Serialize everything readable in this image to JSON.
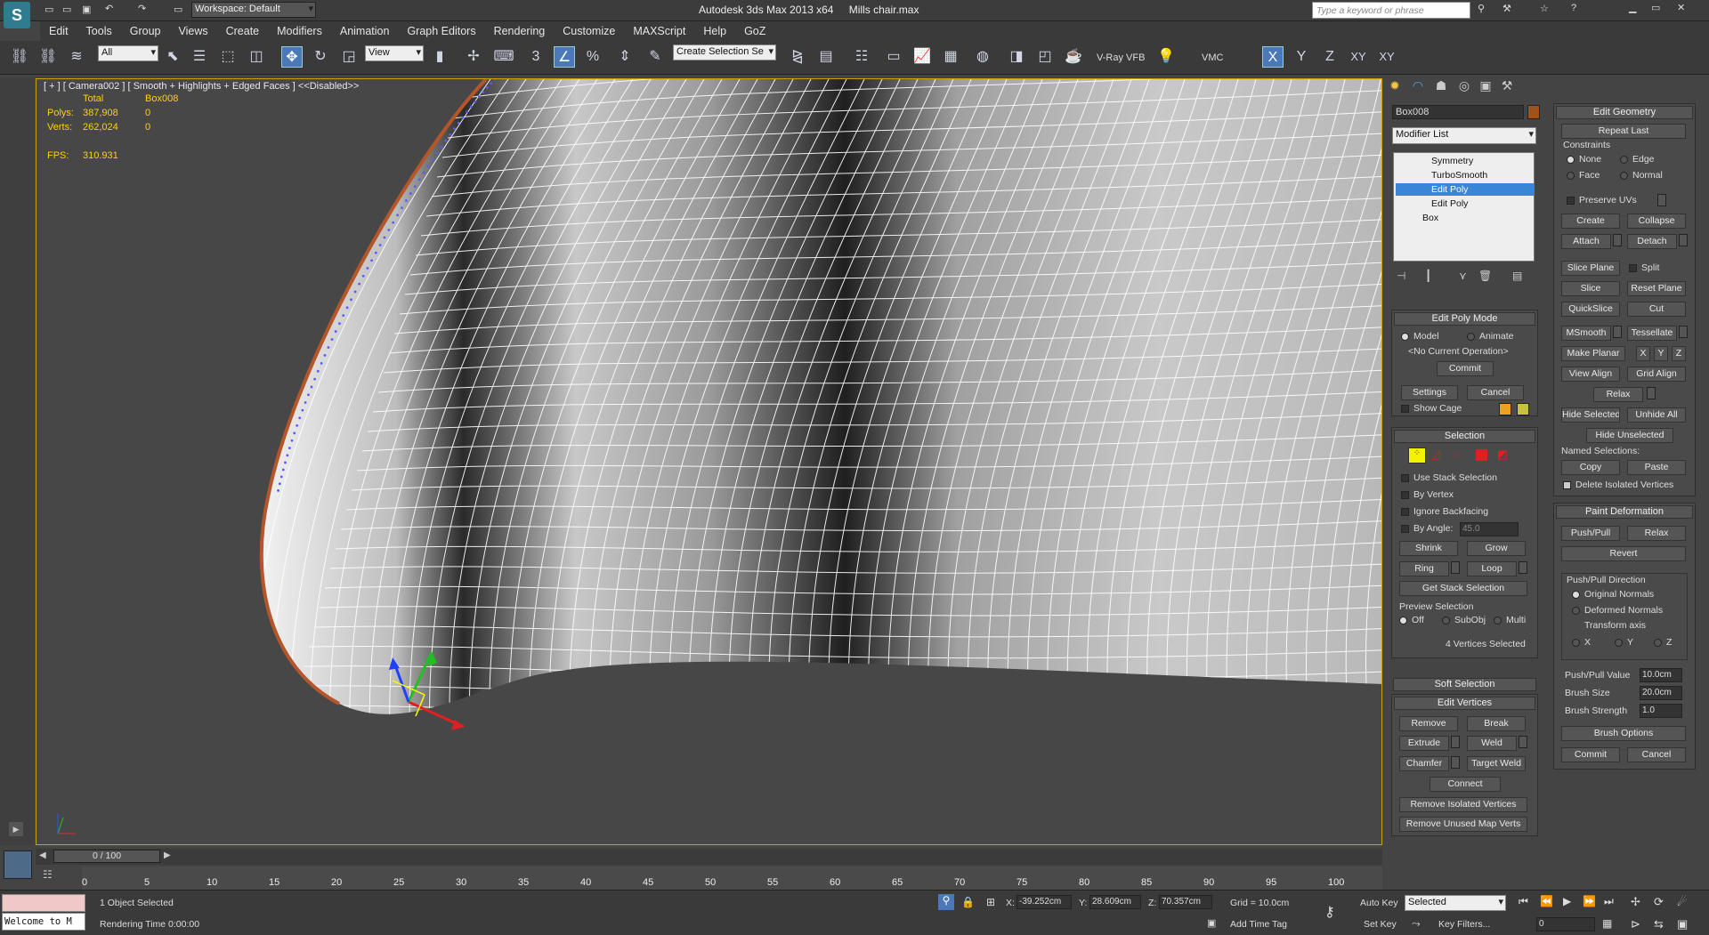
{
  "app": {
    "workspace": "Workspace: Default",
    "title": "Autodesk 3ds Max  2013 x64",
    "file": "Mills chair.max",
    "search_placeholder": "Type a keyword or phrase"
  },
  "menu": [
    "Edit",
    "Tools",
    "Group",
    "Views",
    "Create",
    "Modifiers",
    "Animation",
    "Graph Editors",
    "Rendering",
    "Customize",
    "MAXScript",
    "Help",
    "GoZ"
  ],
  "toolbar": {
    "filter": "All",
    "refcoord": "View",
    "named_sel": "Create Selection Se",
    "vray": "V-Ray VFB",
    "vmc": "VMC",
    "snap3": "3",
    "angle": "%",
    "axis": [
      "X",
      "Y",
      "Z",
      "XY",
      "XY"
    ]
  },
  "viewport": {
    "label": "[ + ] [ Camera002 ] [ Smooth + Highlights + Edged Faces ] <<Disabled>>",
    "stats": {
      "total": "Total",
      "obj": "Box008",
      "polys_label": "Polys:",
      "polys_total": "387,908",
      "polys_obj": "0",
      "verts_label": "Verts:",
      "verts_total": "262,024",
      "verts_obj": "0",
      "fps_label": "FPS:",
      "fps": "310.931"
    }
  },
  "panel": {
    "object_name": "Box008",
    "modifier_list": "Modifier List",
    "stack": [
      "Symmetry",
      "TurboSmooth",
      "Edit Poly",
      "Edit Poly",
      "Box"
    ],
    "edit_poly_mode": {
      "title": "Edit Poly Mode",
      "model": "Model",
      "animate": "Animate",
      "no_op": "<No Current Operation>",
      "commit": "Commit",
      "settings": "Settings",
      "cancel": "Cancel",
      "show_cage": "Show Cage"
    },
    "selection": {
      "title": "Selection",
      "use_stack": "Use Stack Selection",
      "by_vertex": "By Vertex",
      "ignore_backfacing": "Ignore Backfacing",
      "by_angle": "By Angle:",
      "angle": "45.0",
      "shrink": "Shrink",
      "grow": "Grow",
      "ring": "Ring",
      "loop": "Loop",
      "get_stack": "Get Stack Selection",
      "preview": "Preview Selection",
      "off": "Off",
      "subobj": "SubObj",
      "multi": "Multi",
      "status": "4 Vertices Selected"
    },
    "soft_selection": "Soft Selection",
    "edit_vertices": {
      "title": "Edit Vertices",
      "remove": "Remove",
      "break": "Break",
      "extrude": "Extrude",
      "weld": "Weld",
      "chamfer": "Chamfer",
      "target_weld": "Target Weld",
      "connect": "Connect",
      "remove_isolated": "Remove Isolated Vertices",
      "remove_unused": "Remove Unused Map Verts"
    },
    "edit_geometry": {
      "title": "Edit Geometry",
      "repeat_last": "Repeat Last",
      "constraints": "Constraints",
      "none": "None",
      "edge": "Edge",
      "face": "Face",
      "normal": "Normal",
      "preserve_uvs": "Preserve UVs",
      "create": "Create",
      "collapse": "Collapse",
      "attach": "Attach",
      "detach": "Detach",
      "slice_plane": "Slice Plane",
      "split": "Split",
      "slice": "Slice",
      "reset_plane": "Reset Plane",
      "quickslice": "QuickSlice",
      "cut": "Cut",
      "msmooth": "MSmooth",
      "tessellate": "Tessellate",
      "make_planar": "Make Planar",
      "x": "X",
      "y": "Y",
      "z": "Z",
      "view_align": "View Align",
      "grid_align": "Grid Align",
      "relax": "Relax",
      "hide_selected": "Hide Selected",
      "unhide_all": "Unhide All",
      "hide_unselected": "Hide Unselected",
      "named_selections": "Named Selections:",
      "copy": "Copy",
      "paste": "Paste",
      "delete_isolated": "Delete Isolated Vertices"
    },
    "paint_deformation": {
      "title": "Paint Deformation",
      "push_pull": "Push/Pull",
      "relax": "Relax",
      "revert": "Revert",
      "direction": "Push/Pull Direction",
      "original_normals": "Original Normals",
      "deformed_normals": "Deformed Normals",
      "transform_axis": "Transform axis",
      "x": "X",
      "y": "Y",
      "z": "Z",
      "value_label": "Push/Pull Value",
      "value": "10.0cm",
      "brush_size_label": "Brush Size",
      "brush_size": "20.0cm",
      "brush_strength_label": "Brush Strength",
      "brush_strength": "1.0",
      "brush_options": "Brush Options",
      "commit": "Commit",
      "cancel": "Cancel"
    }
  },
  "timeline": {
    "frame": "0 / 100",
    "ticks": [
      "0",
      "5",
      "10",
      "15",
      "20",
      "25",
      "30",
      "35",
      "40",
      "45",
      "50",
      "55",
      "60",
      "65",
      "70",
      "75",
      "80",
      "85",
      "90",
      "95",
      "100"
    ]
  },
  "status": {
    "welcome": "Welcome to M",
    "selected": "1 Object Selected",
    "render_time": "Rendering Time  0:00:00",
    "x": "-39.252cm",
    "y": "28.609cm",
    "z": "70.357cm",
    "grid": "Grid = 10.0cm",
    "add_time_tag": "Add Time Tag",
    "auto_key": "Auto Key",
    "set_key": "Set Key",
    "key_mode": "Selected",
    "key_filters": "Key Filters...",
    "frame": "0"
  },
  "colors": {
    "accent": "#3a86d6",
    "viewport_border": "#c9a100",
    "stats": "#ffd200"
  }
}
